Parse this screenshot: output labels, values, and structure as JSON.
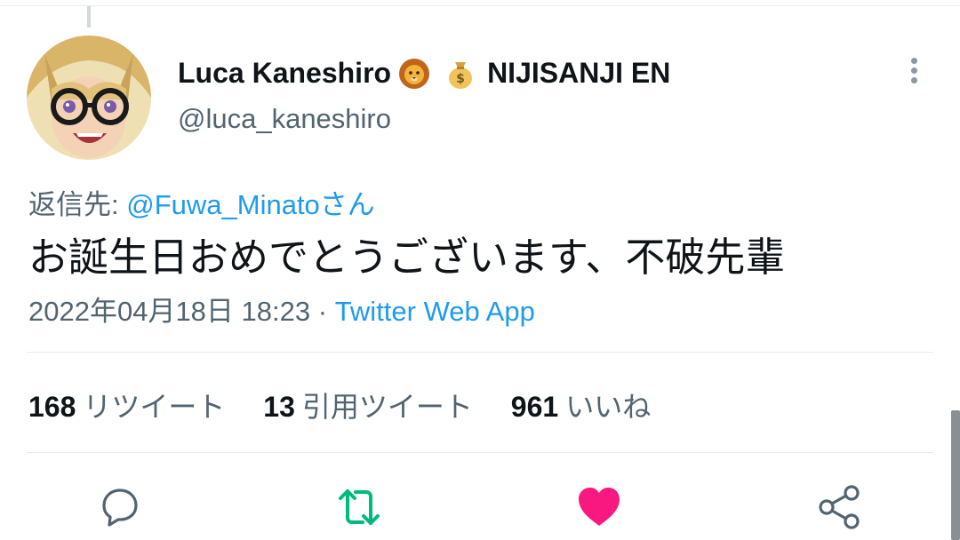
{
  "author": {
    "display_name": "Luca Kaneshiro",
    "org_name": "NIJISANJI EN",
    "handle": "@luca_kaneshiro"
  },
  "reply_to": {
    "prefix": "返信先: ",
    "user": "@Fuwa_Minatoさん"
  },
  "tweet": {
    "text": "お誕生日おめでとうございます、不破先輩",
    "timestamp": "2022年04月18日 18:23",
    "separator": " · ",
    "source": "Twitter Web App"
  },
  "stats": [
    {
      "count": "168",
      "label": "リツイート"
    },
    {
      "count": "13",
      "label": "引用ツイート"
    },
    {
      "count": "961",
      "label": "いいね"
    }
  ],
  "icons": {
    "name_emoji_1": "lion-face-emoji",
    "name_emoji_2": "money-bag-emoji",
    "more": "more-vertical-icon",
    "reply": "reply-icon",
    "retweet": "retweet-icon",
    "like": "heart-icon",
    "share": "share-icon"
  },
  "colors": {
    "link": "#1d9bf0",
    "secondary_text": "#536471",
    "retweet_active": "#00ba7c",
    "like_active": "#f91880"
  }
}
